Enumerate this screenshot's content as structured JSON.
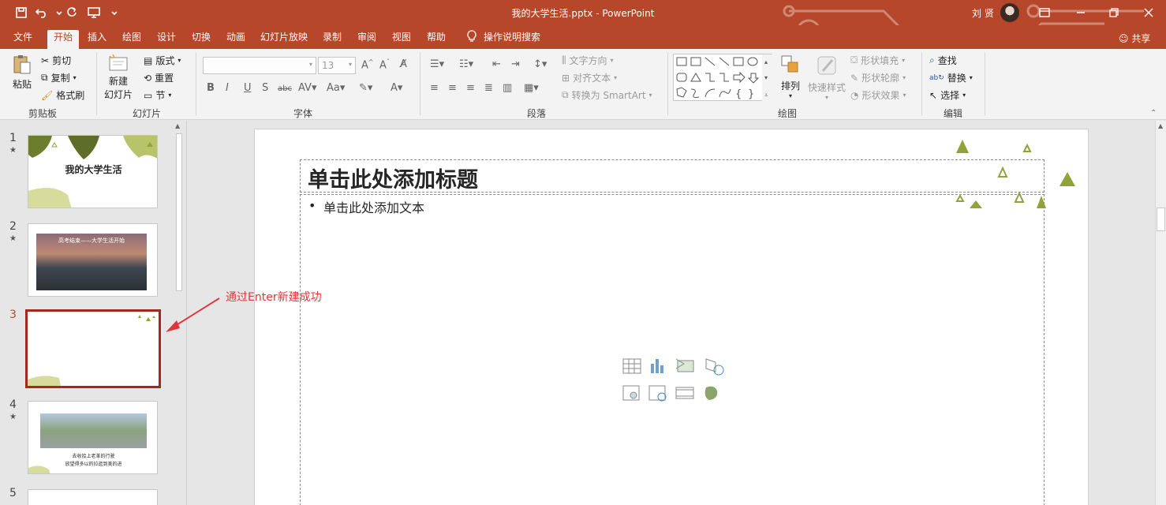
{
  "window": {
    "title": "我的大学生活.pptx  -  PowerPoint",
    "user_name": "刘 贤",
    "colors": {
      "accent": "#b7472a",
      "selection": "#9e2b1b",
      "annotation": "#e0363b",
      "shape": "#8fa33a"
    }
  },
  "quick_access": [
    "save-icon",
    "undo-icon",
    "redo-icon",
    "start-from-beginning-icon",
    "customize-icon"
  ],
  "tabs": [
    {
      "label": "文件"
    },
    {
      "label": "开始"
    },
    {
      "label": "插入"
    },
    {
      "label": "绘图"
    },
    {
      "label": "设计"
    },
    {
      "label": "切换"
    },
    {
      "label": "动画"
    },
    {
      "label": "幻灯片放映"
    },
    {
      "label": "录制"
    },
    {
      "label": "审阅"
    },
    {
      "label": "视图"
    },
    {
      "label": "帮助"
    },
    {
      "label": "操作说明搜索"
    }
  ],
  "share_label": "共享",
  "ribbon": {
    "clipboard": {
      "paste": "粘贴",
      "cut": "剪切",
      "copy": "复制",
      "format_painter": "格式刷",
      "label": "剪贴板"
    },
    "slides": {
      "new_slide_1": "新建",
      "new_slide_2": "幻灯片",
      "layout": "版式",
      "reset": "重置",
      "section": "节",
      "label": "幻灯片"
    },
    "font": {
      "font_name": "",
      "font_size": "13",
      "label": "字体"
    },
    "paragraph": {
      "text_direction": "文字方向",
      "align_text": "对齐文本",
      "smartart": "转换为 SmartArt",
      "label": "段落"
    },
    "drawing": {
      "arrange": "排列",
      "quick_styles": "快速样式",
      "shape_fill": "形状填充",
      "shape_outline": "形状轮廓",
      "shape_effects": "形状效果",
      "label": "绘图"
    },
    "editing": {
      "find": "查找",
      "replace": "替换",
      "select": "选择",
      "label": "编辑"
    }
  },
  "thumbnails": [
    {
      "number": "1",
      "title": "我的大学生活"
    },
    {
      "number": "2",
      "title": "高考结束——大学生活开始"
    },
    {
      "number": "3",
      "title": ""
    },
    {
      "number": "4",
      "line1": "去收拾上老革的行驶",
      "line2": "放望得多以的拉逛到美的进"
    },
    {
      "number": "5"
    }
  ],
  "slide": {
    "title_placeholder": "单击此处添加标题",
    "body_placeholder": "单击此处添加文本",
    "bullet": "•"
  },
  "annotation": "通过Enter新建成功"
}
